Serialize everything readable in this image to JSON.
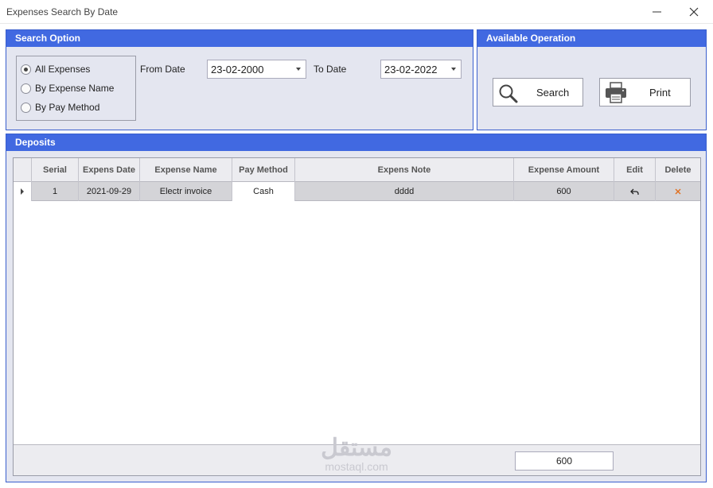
{
  "window": {
    "title": "Expenses Search By Date",
    "minimize_icon": "minimize-icon",
    "close_icon": "close-icon"
  },
  "search_option": {
    "header": "Search Option",
    "radios": [
      {
        "label": "All Expenses",
        "checked": true
      },
      {
        "label": "By Expense Name",
        "checked": false
      },
      {
        "label": "By Pay Method",
        "checked": false
      }
    ],
    "from_date_label": "From Date",
    "from_date_value": "23-02-2000",
    "to_date_label": "To Date",
    "to_date_value": "23-02-2022"
  },
  "operations": {
    "header": "Available Operation",
    "search_label": "Search",
    "search_icon": "search-icon",
    "print_label": "Print",
    "print_icon": "printer-icon"
  },
  "deposits": {
    "header": "Deposits",
    "columns": [
      "Serial",
      "Expens Date",
      "Expense Name",
      "Pay Method",
      "Expens Note",
      "Expense Amount",
      "Edit",
      "Delete"
    ],
    "rows": [
      {
        "serial": "1",
        "date": "2021-09-29",
        "name": "Electr invoice",
        "pay_method": "Cash",
        "note": "dddd",
        "amount": "600",
        "edit_icon": "undo-icon",
        "delete_icon": "delete-x-icon"
      }
    ],
    "total_amount": "600"
  },
  "watermark": {
    "main": "مستقل",
    "sub": "mostaql.com"
  },
  "colors": {
    "header_blue": "#4169e1",
    "panel_bg": "#e4e6f0",
    "delete_x": "#e07020"
  }
}
